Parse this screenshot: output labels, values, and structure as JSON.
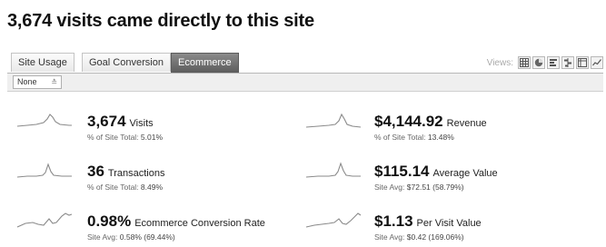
{
  "heading": "3,674 visits came directly to this site",
  "tabs": [
    {
      "label": "Site Usage"
    },
    {
      "label": "Goal Conversion"
    },
    {
      "label": "Ecommerce"
    }
  ],
  "views": {
    "label": "Views:"
  },
  "segment_select": {
    "value": "None"
  },
  "metrics": [
    {
      "value": "3,674",
      "label": "Visits",
      "sub_prefix": "% of Site Total:",
      "sub_value": "5.01%"
    },
    {
      "value": "$4,144.92",
      "label": "Revenue",
      "sub_prefix": "% of Site Total:",
      "sub_value": "13.48%"
    },
    {
      "value": "36",
      "label": "Transactions",
      "sub_prefix": "% of Site Total:",
      "sub_value": "8.49%"
    },
    {
      "value": "$115.14",
      "label": "Average Value",
      "sub_prefix": "Site Avg:",
      "sub_value": "$72.51 (58.79%)"
    },
    {
      "value": "0.98%",
      "label": "Ecommerce Conversion Rate",
      "sub_prefix": "Site Avg:",
      "sub_value": "0.58% (69.44%)"
    },
    {
      "value": "$1.13",
      "label": "Per Visit Value",
      "sub_prefix": "Site Avg:",
      "sub_value": "$0.42 (169.06%)"
    }
  ]
}
